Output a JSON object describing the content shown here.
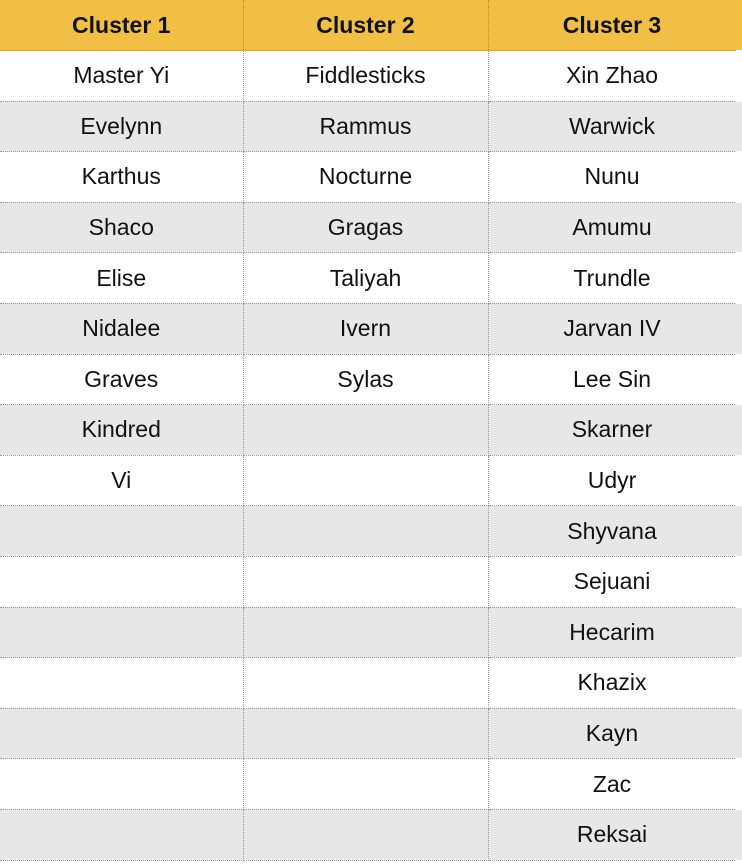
{
  "columns": [
    "Cluster 1",
    "Cluster 2",
    "Cluster 3"
  ],
  "rows": [
    [
      "Master Yi",
      "Fiddlesticks",
      "Xin Zhao"
    ],
    [
      "Evelynn",
      "Rammus",
      "Warwick"
    ],
    [
      "Karthus",
      "Nocturne",
      "Nunu"
    ],
    [
      "Shaco",
      "Gragas",
      "Amumu"
    ],
    [
      "Elise",
      "Taliyah",
      "Trundle"
    ],
    [
      "Nidalee",
      "Ivern",
      "Jarvan IV"
    ],
    [
      "Graves",
      "Sylas",
      "Lee Sin"
    ],
    [
      "Kindred",
      "",
      "Skarner"
    ],
    [
      "Vi",
      "",
      "Udyr"
    ],
    [
      "",
      "",
      "Shyvana"
    ],
    [
      "",
      "",
      "Sejuani"
    ],
    [
      "",
      "",
      "Hecarim"
    ],
    [
      "",
      "",
      "Khazix"
    ],
    [
      "",
      "",
      "Kayn"
    ],
    [
      "",
      "",
      "Zac"
    ],
    [
      "",
      "",
      "Reksai"
    ]
  ],
  "colors": {
    "header_background": "#f1bf45",
    "stripe_background": "#e7e7e7",
    "row_background": "#ffffff"
  }
}
